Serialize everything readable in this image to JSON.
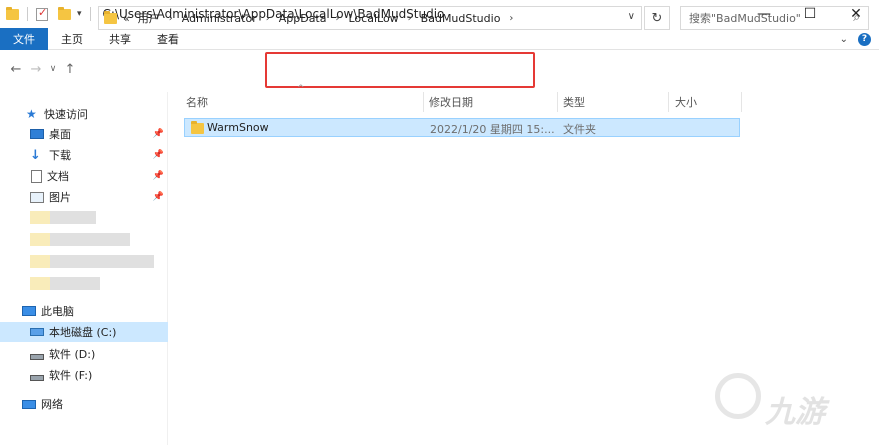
{
  "window": {
    "title_path": "C:\\Users\\Administrator\\AppData\\LocalLow\\BadMudStudio",
    "controls": {
      "minimize": "—",
      "maximize": "☐",
      "close": "✕"
    }
  },
  "ribbon": {
    "tabs": [
      "文件",
      "主页",
      "共享",
      "查看"
    ],
    "expand_glyph": "⌄",
    "help_glyph": "?"
  },
  "nav": {
    "back": "←",
    "forward": "→",
    "recent": "∨",
    "up": "↑"
  },
  "address": {
    "overflow": "«",
    "crumbs": [
      "用户",
      "Administrator",
      "AppData",
      "LocalLow",
      "BadMudStudio"
    ],
    "separator": "›",
    "dropdown_glyph": "∨",
    "refresh_glyph": "↻"
  },
  "search": {
    "placeholder": "搜索\"BadMudStudio\"",
    "icon": "⌕"
  },
  "sidebar": {
    "quick_access": "快速访问",
    "pinned": [
      {
        "label": "桌面",
        "icon": "desktop-icon"
      },
      {
        "label": "下载",
        "icon": "download-icon"
      },
      {
        "label": "文档",
        "icon": "document-icon"
      },
      {
        "label": "图片",
        "icon": "pictures-icon"
      }
    ],
    "pin_glyph": "📌",
    "this_pc": "此电脑",
    "drives": [
      {
        "label": "本地磁盘 (C:)",
        "selected": true
      },
      {
        "label": "软件 (D:)",
        "selected": false
      },
      {
        "label": "软件 (F:)",
        "selected": false
      }
    ],
    "network": "网络"
  },
  "columns": {
    "name": "名称",
    "date": "修改日期",
    "type": "类型",
    "size": "大小",
    "sort_glyph": "^"
  },
  "files": [
    {
      "name": "WarmSnow",
      "date": "2022/1/20 星期四 15:...",
      "type": "文件夹",
      "size": ""
    }
  ],
  "colors": {
    "accent": "#1a6fc2",
    "selection": "#cce8ff",
    "highlight_box": "#e53935"
  }
}
